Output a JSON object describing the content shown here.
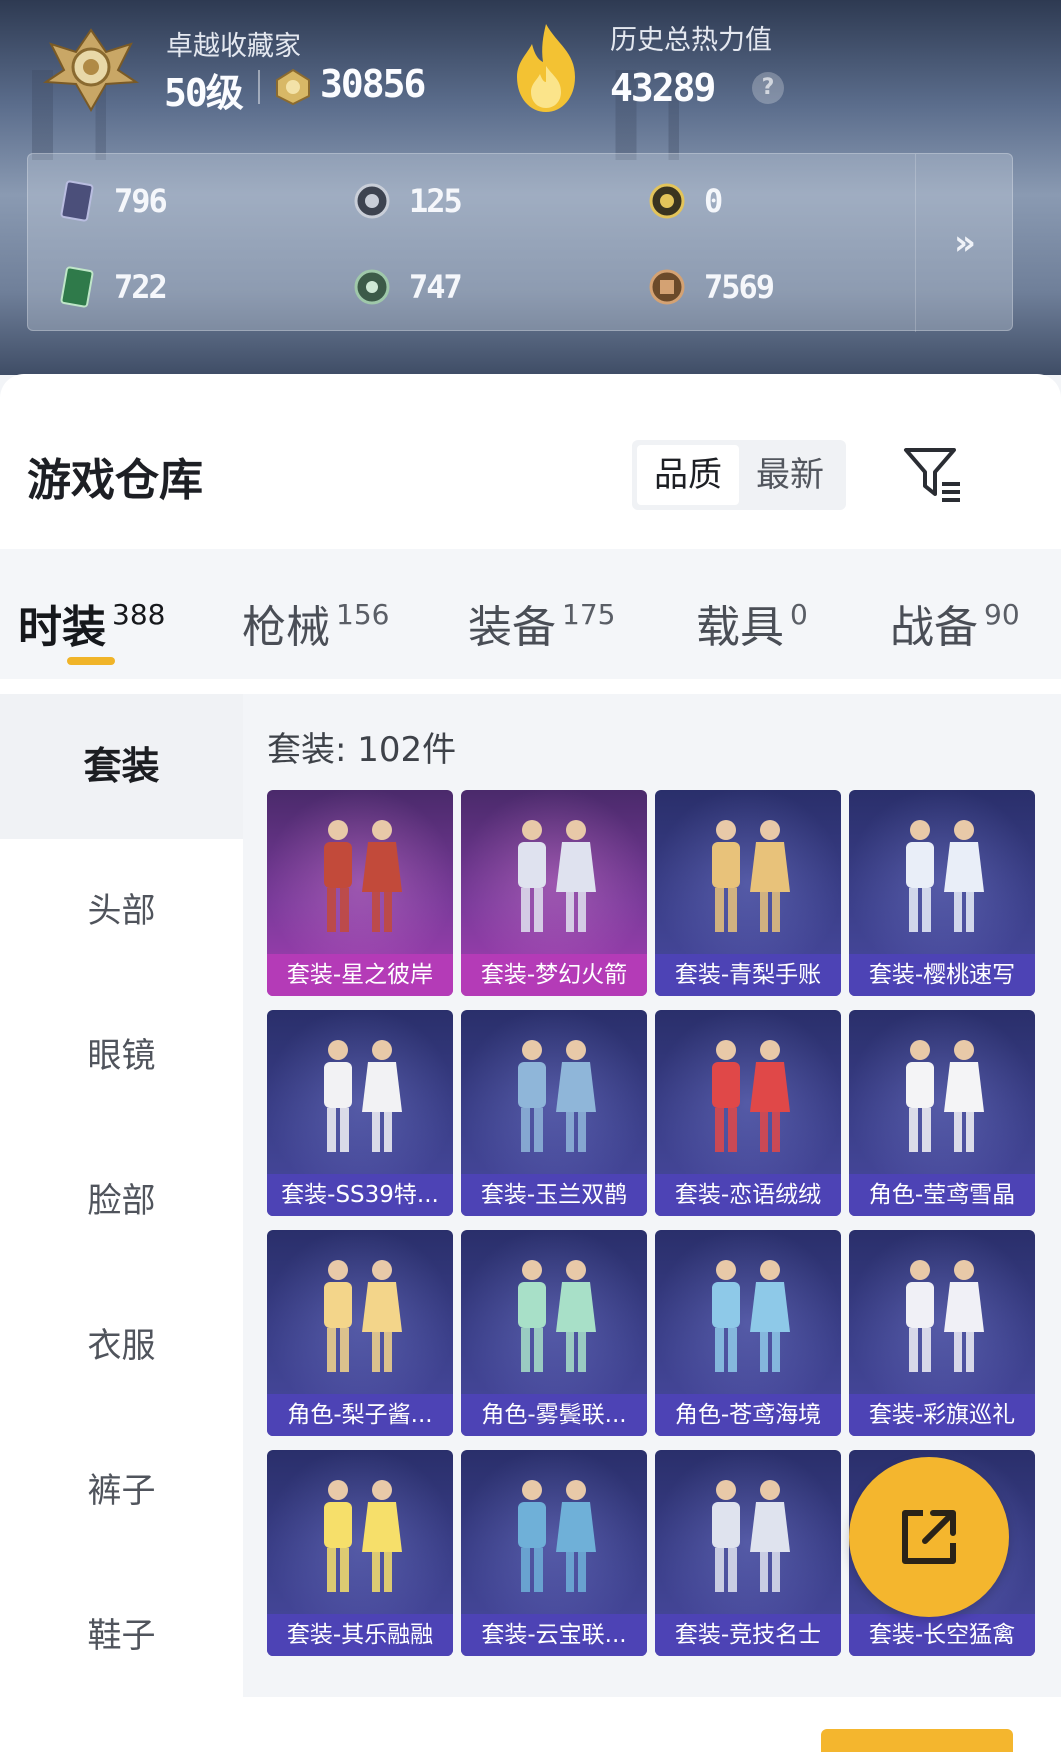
{
  "profile": {
    "rank_title": "卓越收藏家",
    "level": "50级",
    "coin_value": "30856",
    "heat_title": "历史总热力值",
    "heat_value": "43289",
    "help_glyph": "?"
  },
  "stats": [
    {
      "icon": "purple-card-icon",
      "value": "796"
    },
    {
      "icon": "silver-coin-icon",
      "value": "125"
    },
    {
      "icon": "gold-coin-icon",
      "value": "0"
    },
    {
      "icon": "green-card-icon",
      "value": "722"
    },
    {
      "icon": "green-orb-icon",
      "value": "747"
    },
    {
      "icon": "bronze-crate-icon",
      "value": "7569"
    }
  ],
  "stats_more_glyph": "»",
  "warehouse": {
    "title": "游戏仓库",
    "sort_options": [
      "品质",
      "最新"
    ],
    "active_sort": "品质"
  },
  "tabs": [
    {
      "label": "时装",
      "count": "388",
      "active": true
    },
    {
      "label": "枪械",
      "count": "156"
    },
    {
      "label": "装备",
      "count": "175"
    },
    {
      "label": "载具",
      "count": "0"
    },
    {
      "label": "战备",
      "count": "90"
    }
  ],
  "sidebar": [
    "套装",
    "头部",
    "眼镜",
    "脸部",
    "衣服",
    "裤子",
    "鞋子"
  ],
  "count_label": "套装: 102件",
  "items": [
    {
      "name": "套装-星之彼岸",
      "style": "pink"
    },
    {
      "name": "套装-梦幻火箭",
      "style": "pink"
    },
    {
      "name": "套装-青梨手账",
      "style": "blue"
    },
    {
      "name": "套装-樱桃速写",
      "style": "blue"
    },
    {
      "name": "套装-SS39特...",
      "style": "blue"
    },
    {
      "name": "套装-玉兰双鹊",
      "style": "blue"
    },
    {
      "name": "套装-恋语绒绒",
      "style": "blue"
    },
    {
      "name": "角色-莹鸢雪晶",
      "style": "blue"
    },
    {
      "name": "角色-梨子酱...",
      "style": "blue"
    },
    {
      "name": "角色-雾鬓联...",
      "style": "blue"
    },
    {
      "name": "角色-苍鸢海境",
      "style": "blue"
    },
    {
      "name": "套装-彩旗巡礼",
      "style": "blue"
    },
    {
      "name": "套装-其乐融融",
      "style": "blue"
    },
    {
      "name": "套装-云宝联...",
      "style": "blue"
    },
    {
      "name": "套装-竞技名士",
      "style": "blue"
    },
    {
      "name": "套装-长空猛禽",
      "style": "blue"
    }
  ],
  "colors": {
    "accent": "#f4b62e",
    "rare_caption": "#b43bb7",
    "normal_caption": "#4d43b5"
  },
  "share_icon": "share-external-icon"
}
